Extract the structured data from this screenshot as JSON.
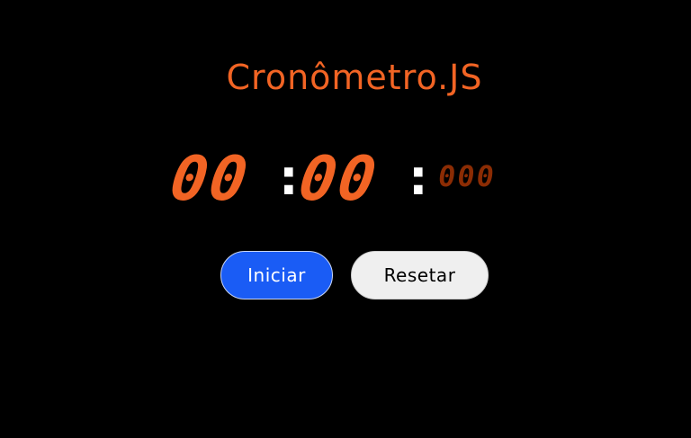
{
  "app": {
    "title": "Cronômetro.JS"
  },
  "timer": {
    "minutes": "00",
    "seconds": "00",
    "milliseconds": "000",
    "separator": ":"
  },
  "controls": {
    "start_label": "Iniciar",
    "reset_label": "Resetar"
  },
  "colors": {
    "background": "#000000",
    "accent": "#f26424",
    "milliseconds": "#8b2c04",
    "separator": "#ffffff",
    "start_button": "#1a5cf5",
    "reset_button": "#efefef"
  }
}
